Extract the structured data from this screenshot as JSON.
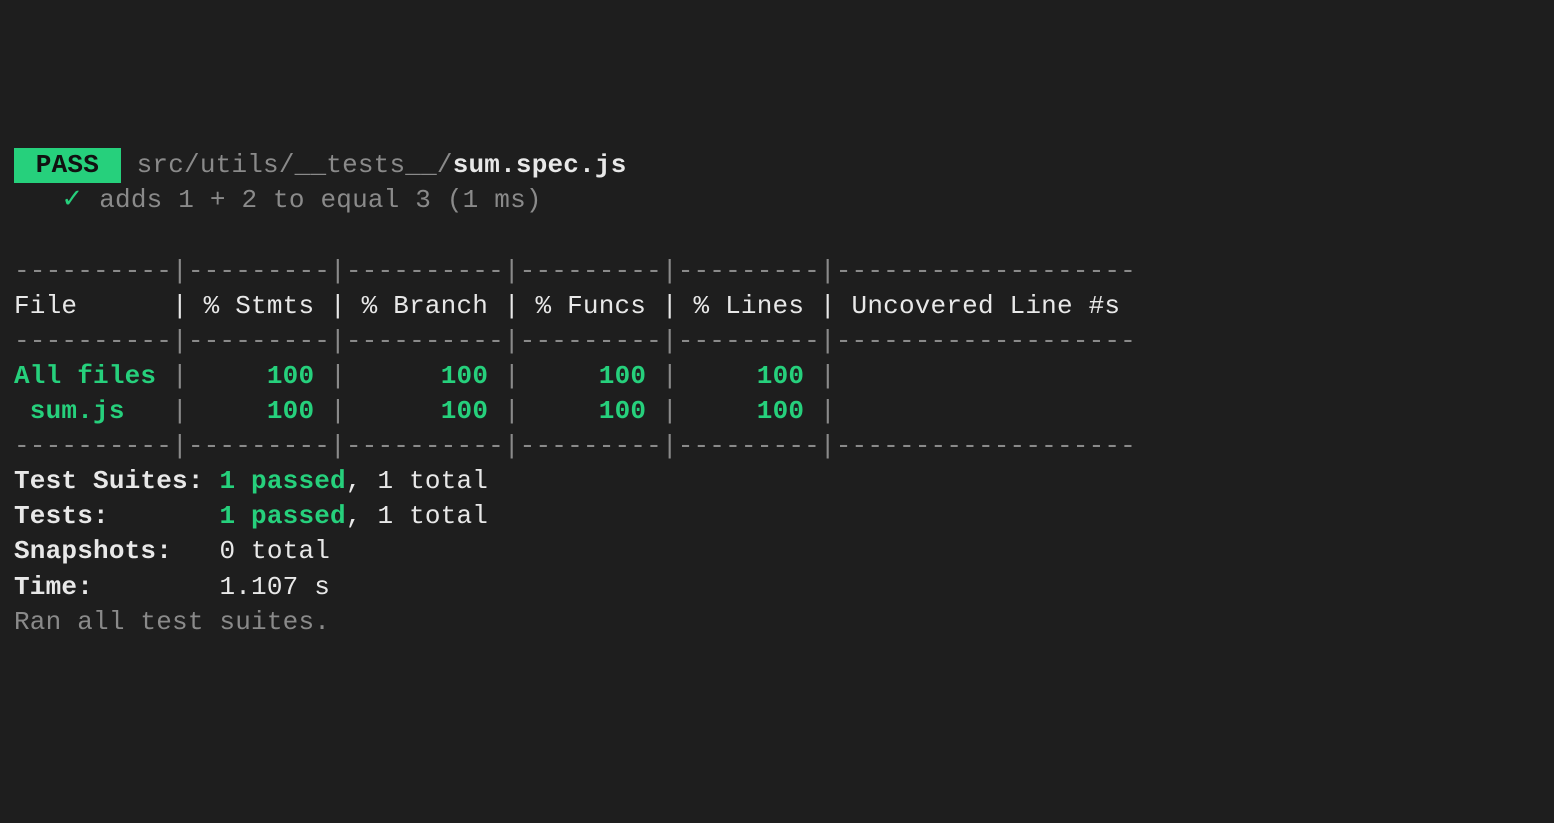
{
  "status": {
    "badge": " PASS ",
    "path_dim": " src/utils/__tests__/",
    "path_bold": "sum.spec.js"
  },
  "test_line": {
    "indent": "   ",
    "check": "✓",
    "desc": " adds 1 + 2 to equal 3 (1 ms)"
  },
  "coverage": {
    "rule_top": "----------|---------|----------|---------|---------|-------------------",
    "header": "File      | % Stmts | % Branch | % Funcs | % Lines | Uncovered Line #s ",
    "rule_mid": "----------|---------|----------|---------|---------|-------------------",
    "rows": [
      {
        "file_seg": "All files",
        "rest": " |     100 |      100 |     100 |     100 | "
      },
      {
        "file_seg": " sum.js  ",
        "rest": " |     100 |      100 |     100 |     100 | "
      }
    ],
    "rule_bot": "----------|---------|----------|---------|---------|-------------------"
  },
  "summary": {
    "suites": {
      "label": "Test Suites: ",
      "passed": "1 passed",
      "rest": ", 1 total"
    },
    "tests": {
      "label": "Tests:       ",
      "passed": "1 passed",
      "rest": ", 1 total"
    },
    "snaps": {
      "label": "Snapshots:   ",
      "value": "0 total"
    },
    "time": {
      "label": "Time:        ",
      "value": "1.107 s"
    },
    "ran": "Ran all test suites."
  },
  "chart_data": {
    "type": "table",
    "title": "Jest coverage report",
    "columns": [
      "File",
      "% Stmts",
      "% Branch",
      "% Funcs",
      "% Lines",
      "Uncovered Line #s"
    ],
    "rows": [
      {
        "File": "All files",
        "% Stmts": 100,
        "% Branch": 100,
        "% Funcs": 100,
        "% Lines": 100,
        "Uncovered Line #s": ""
      },
      {
        "File": "sum.js",
        "% Stmts": 100,
        "% Branch": 100,
        "% Funcs": 100,
        "% Lines": 100,
        "Uncovered Line #s": ""
      }
    ]
  }
}
